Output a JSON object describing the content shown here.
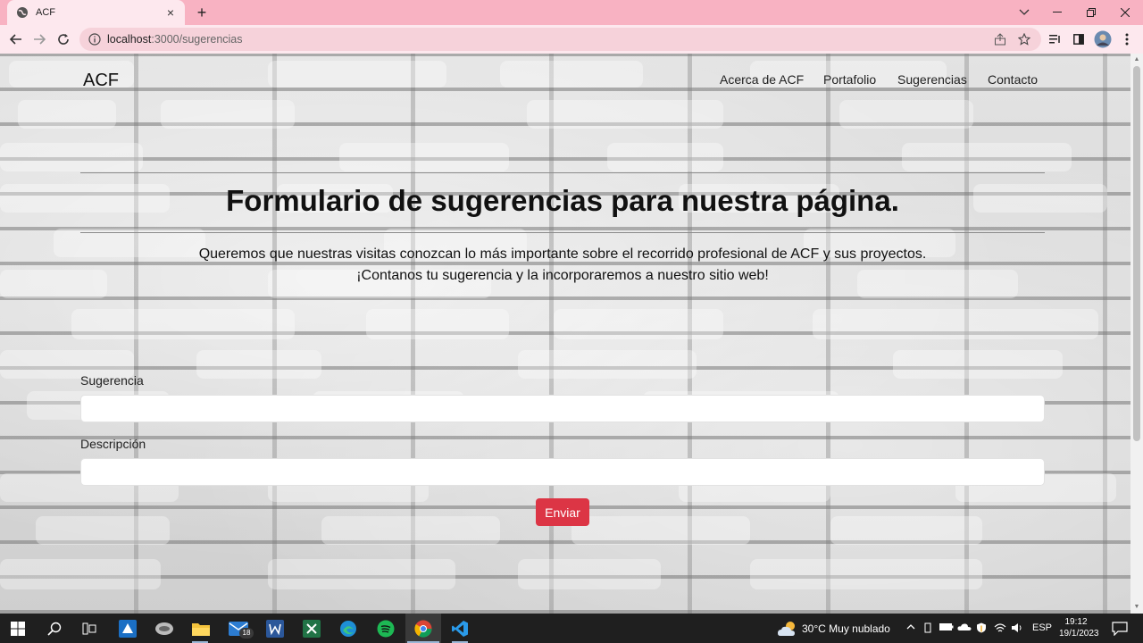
{
  "browser": {
    "tab_title": "ACF",
    "tab_close": "×",
    "new_tab": "+",
    "url_host": "localhost",
    "url_rest": ":3000/sugerencias"
  },
  "site": {
    "brand": "ACF",
    "nav": [
      "Acerca de ACF",
      "Portafolio",
      "Sugerencias",
      "Contacto"
    ]
  },
  "main": {
    "heading": "Formulario de sugerencias para nuestra página.",
    "lead_1": "Queremos que nuestras visitas conozcan lo más importante sobre el recorrido profesional de ACF y sus proyectos.",
    "lead_2": "¡Contanos tu sugerencia y la incorporaremos a nuestro sitio web!"
  },
  "form": {
    "suggestion_label": "Sugerencia",
    "suggestion_value": "",
    "description_label": "Descripción",
    "description_value": "",
    "submit_label": "Enviar"
  },
  "taskbar": {
    "mail_badge": "18",
    "weather": "30°C  Muy nublado",
    "language": "ESP",
    "time": "19:12",
    "date": "19/1/2023"
  },
  "colors": {
    "chrome_tabstrip": "#f8b2c2",
    "chrome_toolbar": "#fde8ee",
    "submit_button": "#dc3545",
    "taskbar": "#1f1f1f"
  }
}
